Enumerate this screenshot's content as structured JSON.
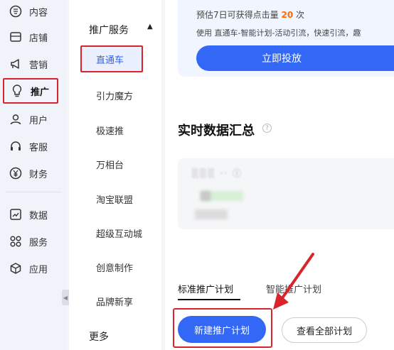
{
  "sidebar": {
    "items": [
      {
        "label": "内容",
        "icon": "content-icon",
        "active": false
      },
      {
        "label": "店铺",
        "icon": "store-icon",
        "active": false
      },
      {
        "label": "营销",
        "icon": "megaphone-icon",
        "active": false
      },
      {
        "label": "推广",
        "icon": "lightbulb-icon",
        "active": true
      },
      {
        "label": "用户",
        "icon": "user-icon",
        "active": false
      },
      {
        "label": "客服",
        "icon": "headset-icon",
        "active": false
      },
      {
        "label": "财务",
        "icon": "yuan-icon",
        "active": false
      },
      {
        "label": "数据",
        "icon": "chart-icon",
        "active": false
      },
      {
        "label": "服务",
        "icon": "grid-icon",
        "active": false
      },
      {
        "label": "应用",
        "icon": "cube-icon",
        "active": false
      }
    ]
  },
  "submenu": {
    "header": "推广服务",
    "items": [
      {
        "label": "直通车",
        "active": true
      },
      {
        "label": "引力魔方",
        "active": false
      },
      {
        "label": "极速推",
        "active": false
      },
      {
        "label": "万相台",
        "active": false
      },
      {
        "label": "淘宝联盟",
        "active": false
      },
      {
        "label": "超级互动城",
        "active": false
      },
      {
        "label": "创意制作",
        "active": false
      },
      {
        "label": "品牌新享",
        "active": false
      }
    ],
    "more": "更多"
  },
  "banner": {
    "line1_prefix": "预估7日可获得点击量",
    "line1_number": "20",
    "line1_suffix": "次",
    "line2": "使用 直通车-智能计划-活动引流，快速引流，趣",
    "cta": "立即投放"
  },
  "realtime": {
    "title": "实时数据汇总"
  },
  "tabs": {
    "standard": "标准推广计划",
    "smart": "智能推广计划"
  },
  "actions": {
    "new_plan": "新建推广计划",
    "view_all": "查看全部计划"
  },
  "colors": {
    "accent": "#3268f5",
    "highlight": "#d9242b",
    "banner_number": "#ff6a00"
  }
}
